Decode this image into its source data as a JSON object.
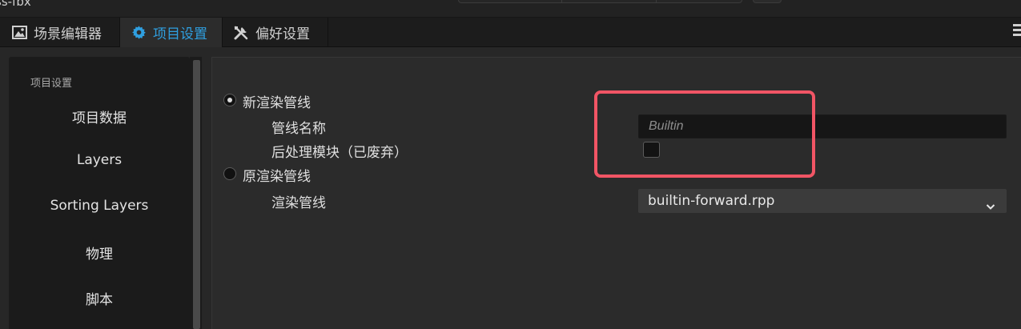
{
  "window": {
    "title": "ss-fbx"
  },
  "tabs": [
    {
      "label": "场景编辑器",
      "icon": "scene-editor-icon"
    },
    {
      "label": "项目设置",
      "icon": "gear-icon"
    },
    {
      "label": "偏好设置",
      "icon": "tools-icon"
    }
  ],
  "sidebar": {
    "header": "项目设置",
    "items": [
      {
        "label": "项目数据"
      },
      {
        "label": "Layers"
      },
      {
        "label": "Sorting Layers"
      },
      {
        "label": "物理"
      },
      {
        "label": "脚本"
      }
    ]
  },
  "render_pipeline": {
    "new_pipeline_label": "新渲染管线",
    "new_pipeline_selected": true,
    "pipeline_name_label": "管线名称",
    "pipeline_name_placeholder": "Builtin",
    "post_process_label": "后处理模块（已废弃）",
    "post_process_checked": false,
    "legacy_pipeline_label": "原渲染管线",
    "legacy_pipeline_selected": false,
    "render_pipeline_label": "渲染管线",
    "render_pipeline_value": "builtin-forward.rpp"
  },
  "colors": {
    "accent": "#2f9fe0",
    "highlight": "#f15565",
    "panel": "#2b2b2b",
    "sidebar": "#1b1b1b"
  }
}
